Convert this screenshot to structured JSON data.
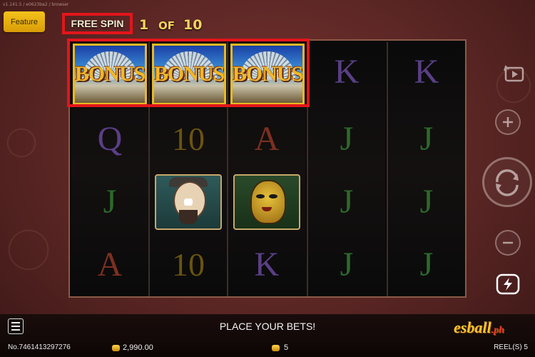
{
  "header": {
    "version_text": "v1.141.5 / e0623ba2 / browser",
    "feature_label": "Feature",
    "free_spin_label": "FREE SPIN",
    "spin_current": "1",
    "spin_of": "OF",
    "spin_total": "10"
  },
  "reels": {
    "count": 5,
    "grid": [
      [
        "BONUS",
        "BONUS",
        "BONUS",
        "K",
        "K"
      ],
      [
        "Q",
        "10",
        "A",
        "J",
        "J"
      ],
      [
        "J",
        "CLOWN",
        "WARRIOR",
        "J",
        "J"
      ],
      [
        "A",
        "10",
        "K",
        "J",
        "J"
      ]
    ],
    "bonus_text": "BONUS"
  },
  "controls": {
    "icons": [
      "auto-spin-icon",
      "plus-icon",
      "spin-icon",
      "minus-icon",
      "turbo-icon"
    ]
  },
  "footer": {
    "status_message": "PLACE YOUR BETS!",
    "ticket_number": "No.7461413297276",
    "balance": "2,990.00",
    "bet": "5",
    "reels_label": "REEL(S) 5",
    "brand_main": "esball",
    "brand_suffix": ".ph"
  },
  "colors": {
    "accent_red": "#e4151b",
    "feature_gold": "#f4c21b",
    "counter_yellow": "#f4d35a"
  }
}
